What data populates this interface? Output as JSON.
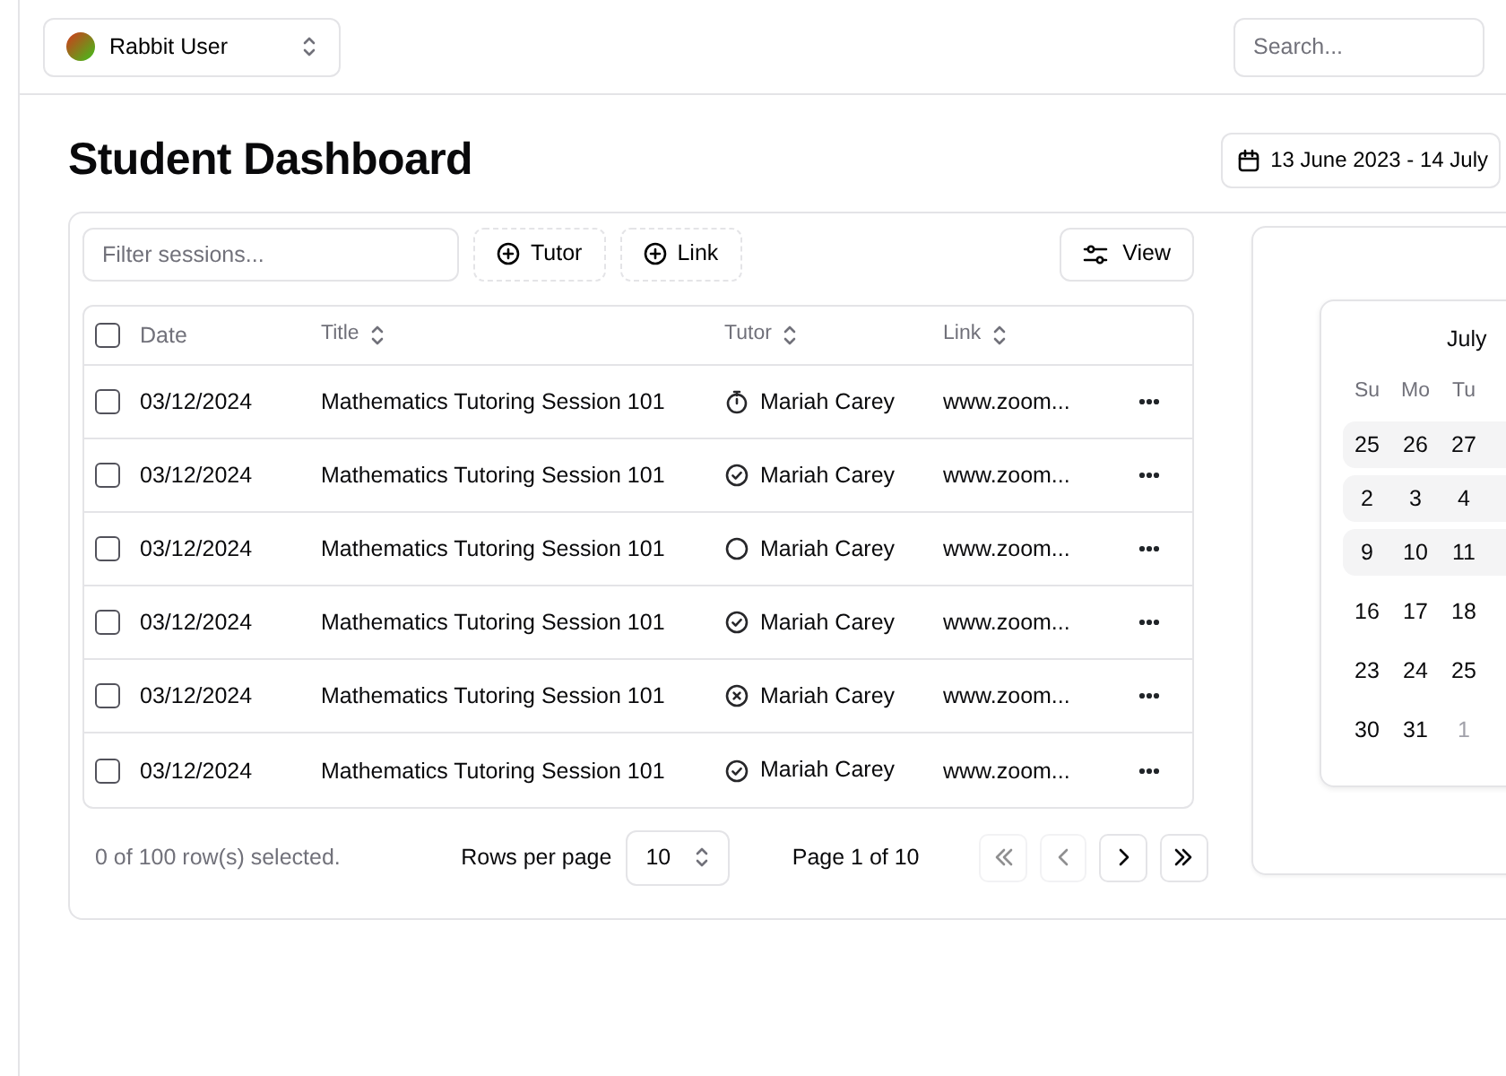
{
  "user_menu": {
    "name": "Rabbit User"
  },
  "search": {
    "placeholder": "Search..."
  },
  "page_title": "Student Dashboard",
  "date_range": "13 June 2023 - 14 July",
  "toolbar": {
    "filter_placeholder": "Filter sessions...",
    "filters": [
      "Tutor",
      "Link"
    ],
    "view_button": "View"
  },
  "table": {
    "header_checked": false,
    "columns": [
      {
        "label": "Date",
        "sortable": false
      },
      {
        "label": "Title",
        "sortable": true
      },
      {
        "label": "Tutor",
        "sortable": true
      },
      {
        "label": "Link",
        "sortable": true
      }
    ],
    "rows": [
      {
        "checked": false,
        "date": "03/12/2024",
        "title": "Mathematics Tutoring Session 101",
        "kind": "timer",
        "tutor": "Mariah Carey",
        "link": "www.zoom..."
      },
      {
        "checked": false,
        "date": "03/12/2024",
        "title": "Mathematics Tutoring Session 101",
        "kind": "done",
        "tutor": "Mariah Carey",
        "link": "www.zoom..."
      },
      {
        "checked": false,
        "date": "03/12/2024",
        "title": "Mathematics Tutoring Session 101",
        "kind": "todo",
        "tutor": "Mariah Carey",
        "link": "www.zoom..."
      },
      {
        "checked": false,
        "date": "03/12/2024",
        "title": "Mathematics Tutoring Session 101",
        "kind": "done",
        "tutor": "Mariah Carey",
        "link": "www.zoom..."
      },
      {
        "checked": false,
        "date": "03/12/2024",
        "title": "Mathematics Tutoring Session 101",
        "kind": "canceled",
        "tutor": "Mariah Carey",
        "link": "www.zoom..."
      },
      {
        "checked": false,
        "date": "03/12/2024",
        "title": "Mathematics Tutoring Session 101",
        "kind": "done",
        "tutor": "Mariah Carey",
        "link": "www.zoom..."
      }
    ]
  },
  "pagination": {
    "selection": "0 of 100 row(s) selected.",
    "rows_per_page_label": "Rows per page",
    "rows_per_page": "10",
    "page": "Page 1 of 10",
    "buttons": [
      {
        "kind": "first",
        "disabled": true
      },
      {
        "kind": "prev",
        "disabled": true
      },
      {
        "kind": "next",
        "disabled": false
      },
      {
        "kind": "last",
        "disabled": false
      }
    ]
  },
  "calendar": {
    "month": "July",
    "weekdays": [
      "Su",
      "Mo",
      "Tu"
    ],
    "weeks": [
      {
        "in_range": true,
        "days": [
          {
            "label": "25",
            "muted": false
          },
          {
            "label": "26",
            "muted": false
          },
          {
            "label": "27",
            "muted": false
          }
        ]
      },
      {
        "in_range": true,
        "days": [
          {
            "label": "2",
            "muted": false
          },
          {
            "label": "3",
            "muted": false
          },
          {
            "label": "4",
            "muted": false
          }
        ]
      },
      {
        "in_range": true,
        "days": [
          {
            "label": "9",
            "muted": false
          },
          {
            "label": "10",
            "muted": false
          },
          {
            "label": "11",
            "muted": false
          }
        ]
      },
      {
        "in_range": false,
        "days": [
          {
            "label": "16",
            "muted": false
          },
          {
            "label": "17",
            "muted": false
          },
          {
            "label": "18",
            "muted": false
          }
        ]
      },
      {
        "in_range": false,
        "days": [
          {
            "label": "23",
            "muted": false
          },
          {
            "label": "24",
            "muted": false
          },
          {
            "label": "25",
            "muted": false
          }
        ]
      },
      {
        "in_range": false,
        "days": [
          {
            "label": "30",
            "muted": false
          },
          {
            "label": "31",
            "muted": false
          },
          {
            "label": "1",
            "muted": true
          }
        ]
      }
    ]
  }
}
